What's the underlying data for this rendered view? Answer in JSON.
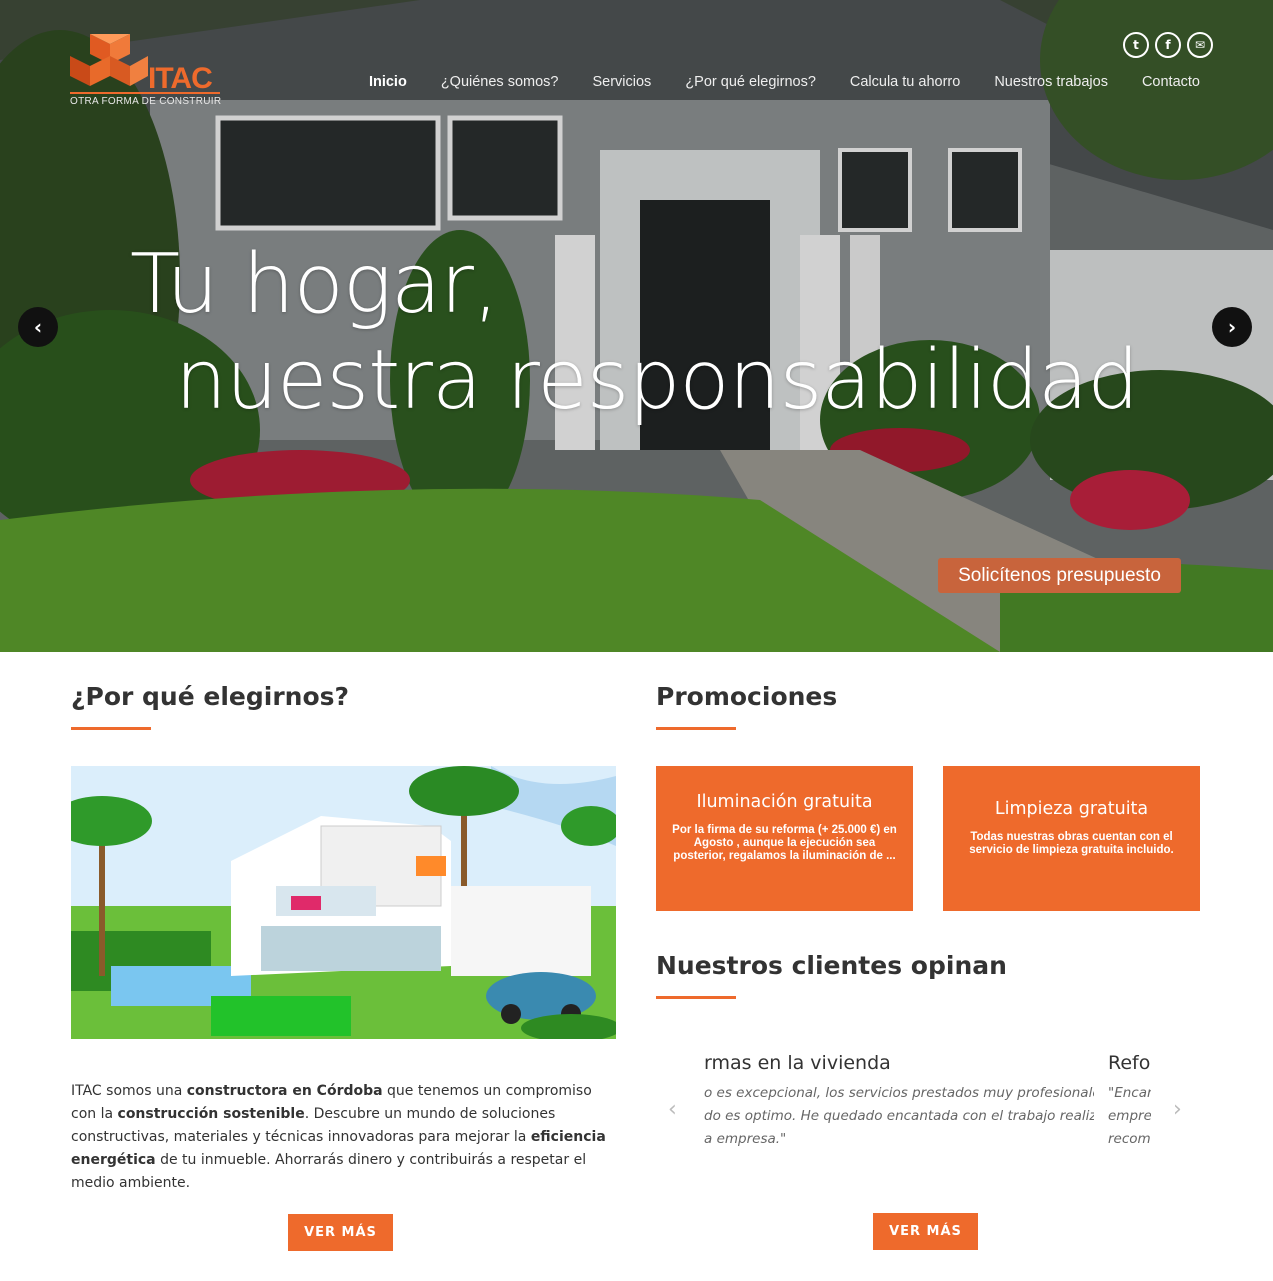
{
  "brand": {
    "name": "ITAC",
    "tagline": "OTRA FORMA DE CONSTRUIR"
  },
  "social": [
    {
      "icon": "twitter-icon",
      "glyph": "t"
    },
    {
      "icon": "facebook-icon",
      "glyph": "f"
    },
    {
      "icon": "email-icon",
      "glyph": "✉"
    }
  ],
  "nav": {
    "items": [
      "Inicio",
      "¿Quiénes somos?",
      "Servicios",
      "¿Por qué elegirnos?",
      "Calcula tu ahorro",
      "Nuestros trabajos",
      "Contacto"
    ],
    "active": "Inicio"
  },
  "hero": {
    "line1": "Tu hogar,",
    "line2": "nuestra responsabilidad",
    "cta": "Solicítenos presupuesto",
    "prev_glyph": "‹",
    "next_glyph": "›"
  },
  "why": {
    "title": "¿Por qué elegirnos?",
    "intro": [
      {
        "t": "ITAC somos una ",
        "b": false
      },
      {
        "t": "constructora en Córdoba",
        "b": true
      },
      {
        "t": " que tenemos un compromiso con la ",
        "b": false
      },
      {
        "t": "construcción sostenible",
        "b": true
      },
      {
        "t": ". Descubre un mundo de soluciones constructivas, materiales y técnicas innovadoras para mejorar la ",
        "b": false
      },
      {
        "t": "eficiencia energética",
        "b": true
      },
      {
        "t": " de tu inmueble. Ahorrarás dinero y contribuirás a respetar el medio ambiente.",
        "b": false
      }
    ],
    "button": "VER MÁS"
  },
  "promotions": {
    "title": "Promociones",
    "items": [
      {
        "title": "Iluminación gratuita",
        "desc": "Por la firma de su reforma (+ 25.000 €) en Agosto , aunque la ejecución sea posterior, regalamos la iluminación de ..."
      },
      {
        "title": "Limpieza gratuita",
        "desc": "Todas nuestras obras cuentan con el servicio de limpieza gratuita incluido."
      }
    ]
  },
  "testimonials": {
    "title": "Nuestros clientes opinan",
    "slide1": {
      "title": "rmas en la vivienda",
      "lines": [
        "o es excepcional, los servicios prestados muy profesionales y el",
        "do es optimo. He quedado encantada con el trabajo realizado",
        "a empresa.\""
      ]
    },
    "slide2": {
      "title": "Refo",
      "lines": [
        "\"Encan",
        "empres",
        "recomi"
      ]
    },
    "prev_glyph": "‹",
    "next_glyph": "›",
    "button": "VER MÁS"
  },
  "colors": {
    "accent": "#ee6a2c",
    "cta": "#c8643c"
  }
}
